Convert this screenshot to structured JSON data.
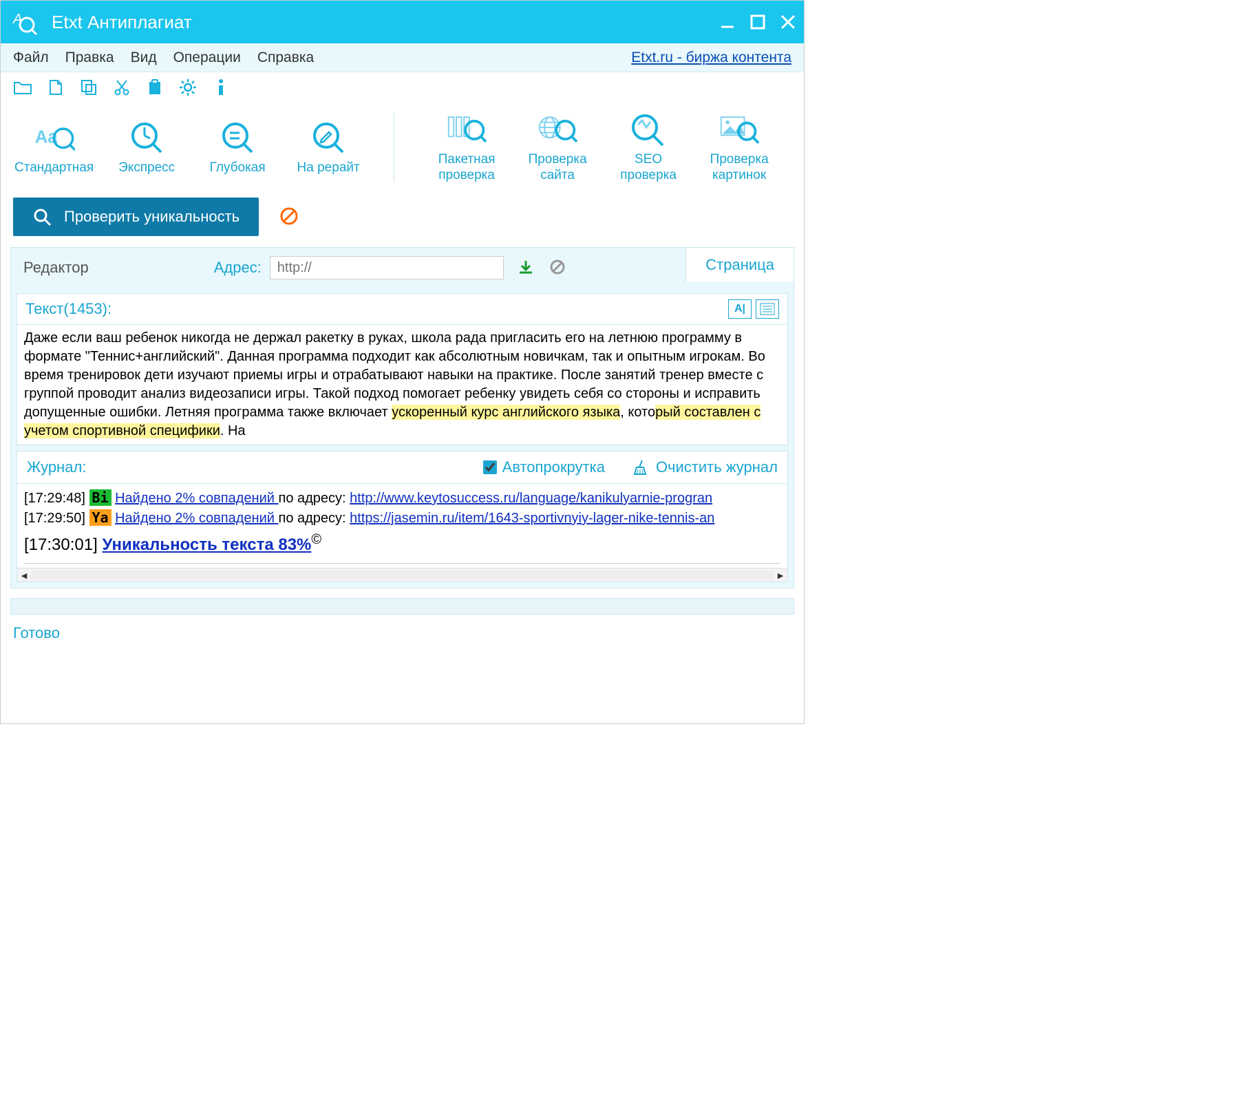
{
  "titlebar": {
    "app_title": "Etxt Антиплагиат"
  },
  "menubar": {
    "items": [
      "Файл",
      "Правка",
      "Вид",
      "Операции",
      "Справка"
    ],
    "link": "Etxt.ru - биржа контента"
  },
  "big_tools_left": [
    {
      "label": "Стандартная"
    },
    {
      "label": "Экспресс"
    },
    {
      "label": "Глубокая"
    },
    {
      "label": "На рерайт"
    }
  ],
  "big_tools_right": [
    {
      "label": "Пакетная\nпроверка"
    },
    {
      "label": "Проверка\nсайта"
    },
    {
      "label": "SEO\nпроверка"
    },
    {
      "label": "Проверка\nкартинок"
    }
  ],
  "check_button": "Проверить уникальность",
  "editor": {
    "label": "Редактор",
    "address_label": "Адрес:",
    "address_placeholder": "http://",
    "tab_page": "Страница"
  },
  "text": {
    "head": "Текст(1453):",
    "body_plain1": "Даже если ваш ребенок никогда не держал ракетку в руках, школа рада пригласить его на летнюю программу в формате \"Теннис+английский\". Данная программа подходит как абсолютным новичкам, так и опытным игрокам. Во время тренировок дети изучают приемы игры и отрабатывают навыки на практике. После занятий тренер вместе с группой проводит анализ видеозаписи игры. Такой подход помогает ребенку увидеть себя со стороны и исправить допущенные ошибки. Летняя программа также включает ",
    "body_hl1": "ускоренный курс английского языка",
    "body_plain2": ", кото",
    "body_hl2": "рый составлен с учетом спортивной специфики",
    "body_plain3": ". На"
  },
  "log": {
    "head": "Журнал:",
    "autoscroll": "Автопрокрутка",
    "clear": "Очистить журнал",
    "lines": [
      {
        "ts": "[17:29:48]",
        "badge": "Bi",
        "badge_cls": "bi",
        "match": "Найдено 2% совпадений ",
        "addr": "по адресу: ",
        "url": "http://www.keytosuccess.ru/language/kanikulyarnie-progran"
      },
      {
        "ts": "[17:29:50]",
        "badge": "Ya",
        "badge_cls": "ya",
        "match": "Найдено 2% совпадений ",
        "addr": "по адресу: ",
        "url": "https://jasemin.ru/item/1643-sportivnyiy-lager-nike-tennis-an"
      }
    ],
    "result_ts": "[17:30:01]",
    "result_text": "Уникальность текста 83%",
    "result_sup": "©"
  },
  "status": "Готово"
}
